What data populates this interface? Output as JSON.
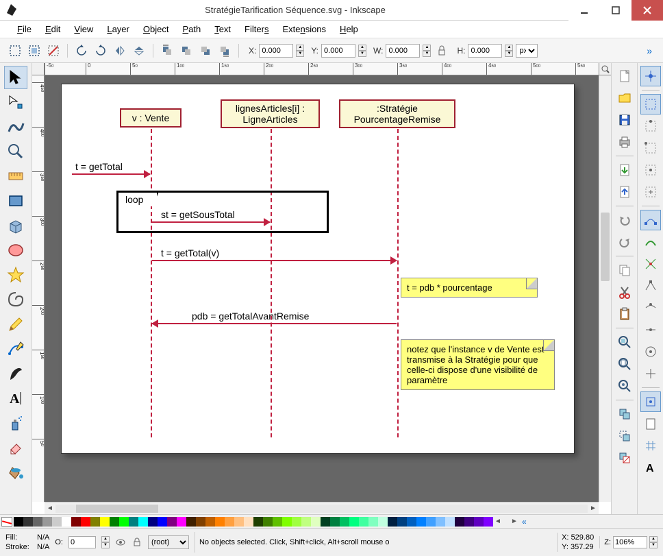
{
  "window": {
    "title": "StratégieTarification Séquence.svg - Inkscape"
  },
  "menu": {
    "file": "File",
    "edit": "Edit",
    "view": "View",
    "layer": "Layer",
    "object": "Object",
    "path": "Path",
    "text": "Text",
    "filters": "Filters",
    "extensions": "Extensions",
    "help": "Help"
  },
  "toolbar": {
    "x_label": "X:",
    "x_value": "0.000",
    "y_label": "Y:",
    "y_value": "0.000",
    "w_label": "W:",
    "w_value": "0.000",
    "h_label": "H:",
    "h_value": "0.000",
    "unit": "px"
  },
  "ruler_h": [
    "-5,0",
    "0",
    "5,0",
    "100",
    "150",
    "200",
    "250",
    "300",
    "350",
    "400",
    "450",
    "500",
    "550"
  ],
  "ruler_v": [
    "450",
    "400",
    "350",
    "300",
    "250",
    "200",
    "150",
    "100",
    "50"
  ],
  "diagram": {
    "box_vente": "v : Vente",
    "box_ligne": "lignesArticles[i] : LigneArticles",
    "box_strategie": ":Stratégie PourcentageRemise",
    "msg_getTotal": "t = getTotal",
    "loop_label": "loop",
    "msg_getSousTotal": "st = getSousTotal",
    "msg_getTotalV": "t = getTotal(v)",
    "note_formula": "t = pdb * pourcentage",
    "msg_pdb": "pdb = getTotalAvantRemise",
    "note_big": "notez que l'instance v de Vente est transmise à la Stratégie pour que celle-ci dispose d'une visibilité de paramètre"
  },
  "palette_colors": [
    "#000000",
    "#333333",
    "#666666",
    "#999999",
    "#cccccc",
    "#ffffff",
    "#800000",
    "#ff0000",
    "#808000",
    "#ffff00",
    "#008000",
    "#00ff00",
    "#008080",
    "#00ffff",
    "#000080",
    "#0000ff",
    "#800080",
    "#ff00ff",
    "#402000",
    "#804000",
    "#c06000",
    "#ff8000",
    "#ffa040",
    "#ffc080",
    "#ffe0c0",
    "#204000",
    "#408000",
    "#60c000",
    "#80ff00",
    "#a0ff40",
    "#c0ff80",
    "#e0ffc0",
    "#004020",
    "#008040",
    "#00c060",
    "#00ff80",
    "#40ffa0",
    "#80ffc0",
    "#c0ffe0",
    "#002040",
    "#004080",
    "#0060c0",
    "#0080ff",
    "#40a0ff",
    "#80c0ff",
    "#c0e0ff",
    "#200040",
    "#400080",
    "#6000c0",
    "#8000ff"
  ],
  "status": {
    "fill_label": "Fill:",
    "fill_value": "N/A",
    "stroke_label": "Stroke:",
    "stroke_value": "N/A",
    "opacity_label": "O:",
    "opacity_value": "0",
    "layer_value": "(root)",
    "message": "No objects selected. Click, Shift+click, Alt+scroll mouse o",
    "x_label": "X:",
    "x_value": "529.80",
    "y_label": "Y:",
    "y_value": "357.29",
    "z_label": "Z:",
    "z_value": "106%"
  }
}
